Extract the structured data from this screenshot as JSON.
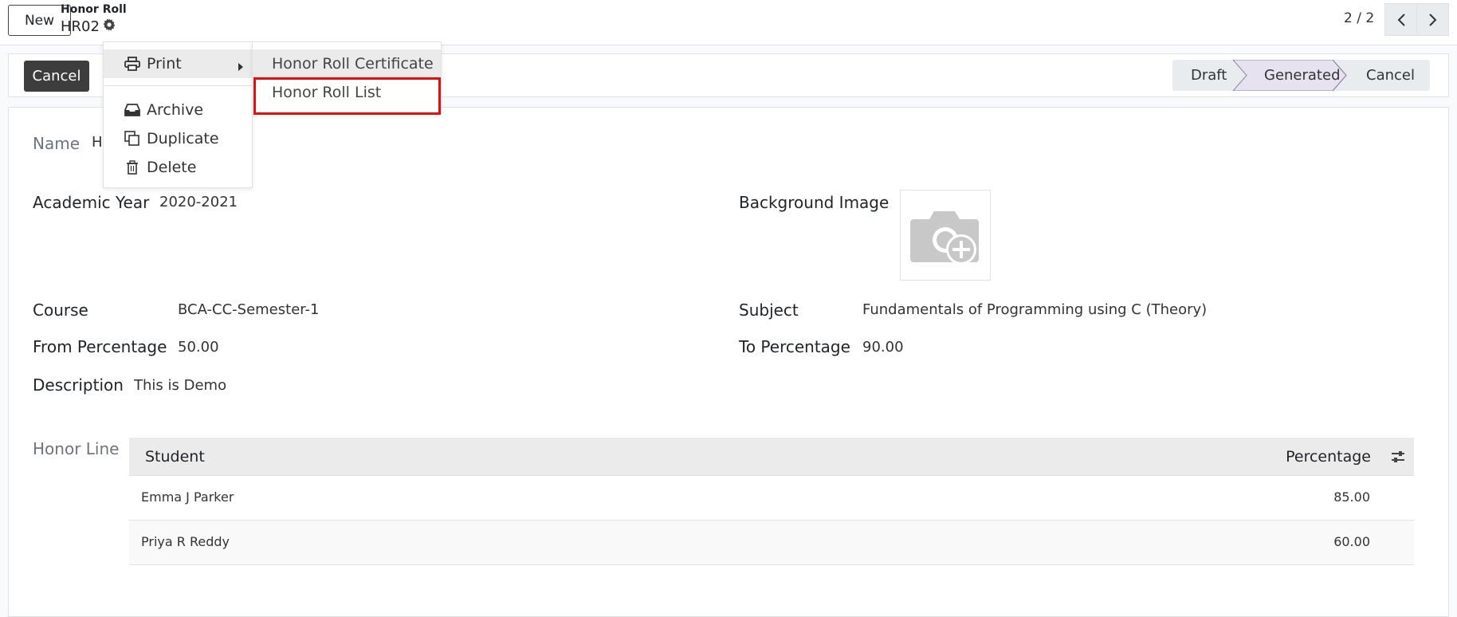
{
  "control_panel": {
    "new_label": "New",
    "breadcrumb_parent": "Honor Roll",
    "breadcrumb_current": "HR02",
    "pager": "2 / 2"
  },
  "statusbar": {
    "cancel_label": "Cancel",
    "stages": [
      "Draft",
      "Generated",
      "Cancel"
    ],
    "active_stage": "Generated"
  },
  "form": {
    "name_label": "Name",
    "name_value_partial": "H",
    "academic_year_label": "Academic Year",
    "academic_year_value": "2020-2021",
    "background_image_label": "Background Image",
    "course_label": "Course",
    "course_value": "BCA-CC-Semester-1",
    "subject_label": "Subject",
    "subject_value": "Fundamentals of Programming using C (Theory)",
    "from_percentage_label": "From Percentage",
    "from_percentage_value": "50.00",
    "to_percentage_label": "To Percentage",
    "to_percentage_value": "90.00",
    "description_label": "Description",
    "description_value": "This is Demo",
    "honor_line_label": "Honor Line"
  },
  "honor_lines": {
    "columns": [
      "Student",
      "Percentage"
    ],
    "rows": [
      {
        "student": "Emma J Parker",
        "percentage": "85.00"
      },
      {
        "student": "Priya R Reddy",
        "percentage": "60.00"
      }
    ]
  },
  "action_menu": {
    "items": [
      {
        "label": "Print",
        "icon": "print-icon"
      },
      {
        "label": "Archive",
        "icon": "archive-icon"
      },
      {
        "label": "Duplicate",
        "icon": "duplicate-icon"
      },
      {
        "label": "Delete",
        "icon": "trash-icon"
      }
    ]
  },
  "print_submenu": {
    "items": [
      "Honor Roll Certificate",
      "Honor Roll List"
    ]
  },
  "colors": {
    "highlight": "#e01010",
    "dark_button": "#3d3d3d",
    "active_stage": "#e6e2f0"
  }
}
